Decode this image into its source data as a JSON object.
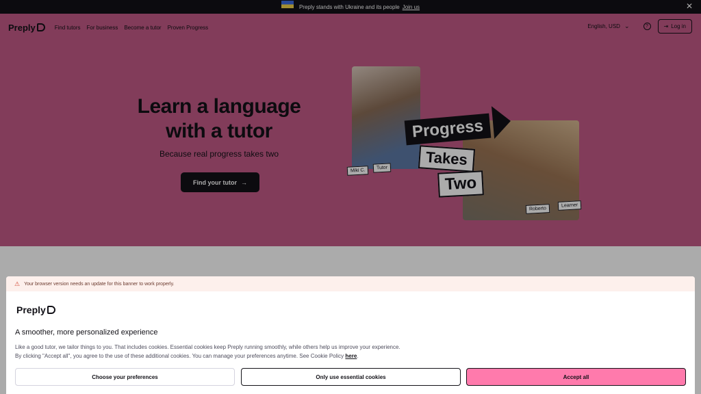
{
  "banner": {
    "text": "Preply stands with Ukraine and its people",
    "link": "Join us",
    "close": "✕"
  },
  "nav": {
    "logo": "Preply",
    "links": [
      "Find tutors",
      "For business",
      "Become a tutor",
      "Proven Progress"
    ],
    "language": "English, USD",
    "help": "?",
    "login": "Log in"
  },
  "hero": {
    "title_line1": "Learn a language",
    "title_line2": "with a tutor",
    "subtitle": "Because real progress takes two",
    "cta": "Find your tutor",
    "tags": {
      "miki": "Miki C.",
      "tutor": "Tutor",
      "roberto": "Roberto",
      "learner": "Learner"
    },
    "graphic": {
      "progress": "Progress",
      "takes": "Takes",
      "two": "Two"
    }
  },
  "cookie": {
    "warning": "Your browser version needs an update for this banner to work properly.",
    "logo": "Preply",
    "heading": "A smoother, more personalized experience",
    "body_line1": "Like a good tutor, we tailor things to you. That includes cookies. Essential cookies keep Preply running smoothly, while others help us improve your experience.",
    "body_line2": "By clicking \"Accept all\", you agree to the use of these additional cookies. You can manage your preferences anytime. See Cookie Policy",
    "policy_link": "here",
    "btn_prefs": "Choose your preferences",
    "btn_essential": "Only use essential cookies",
    "btn_accept": "Accept all"
  },
  "colors": {
    "hero": "#c25a86",
    "accent": "#ff7aac",
    "dark": "#121117"
  }
}
